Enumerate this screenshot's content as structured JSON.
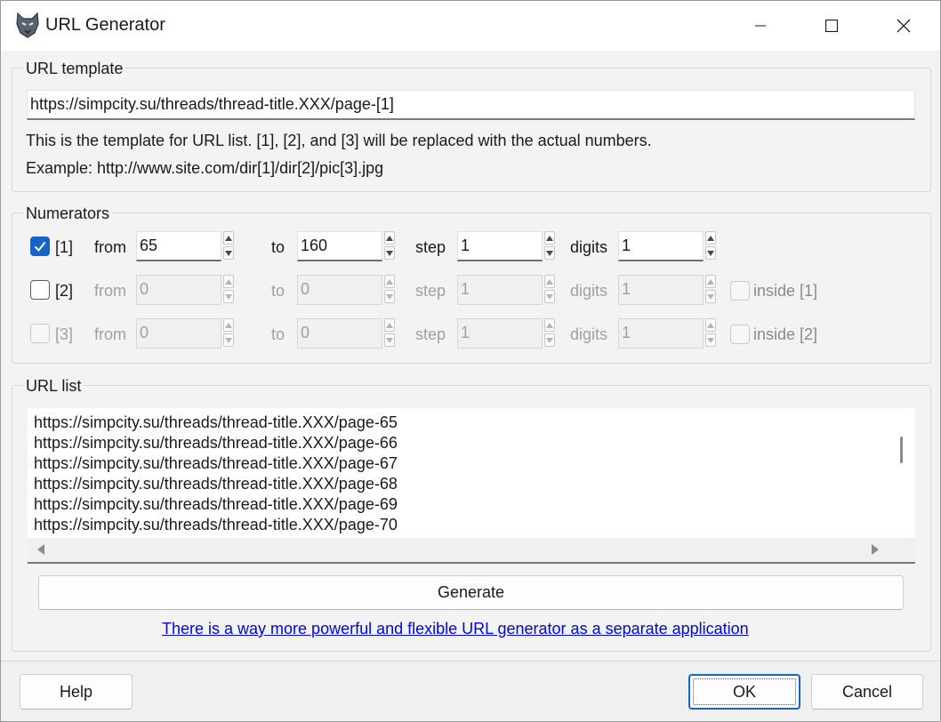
{
  "window": {
    "title": "URL Generator",
    "icon": "wolf-app-icon"
  },
  "template_group": {
    "label": "URL template",
    "value": "https://simpcity.su/threads/thread-title.XXX/page-[1]",
    "help_line1": "This is the template for URL list. [1], [2], and [3] will be replaced with the actual numbers.",
    "help_line2": "Example: http://www.site.com/dir[1]/dir[2]/pic[3].jpg"
  },
  "numerators": {
    "label": "Numerators",
    "from_label": "from",
    "to_label": "to",
    "step_label": "step",
    "digits_label": "digits",
    "rows": [
      {
        "tag": "[1]",
        "checked": true,
        "enabled": true,
        "from": "65",
        "to": "160",
        "step": "1",
        "digits": "1",
        "inside_label": ""
      },
      {
        "tag": "[2]",
        "checked": false,
        "enabled": true,
        "from": "0",
        "to": "0",
        "step": "1",
        "digits": "1",
        "inside_label": "inside [1]"
      },
      {
        "tag": "[3]",
        "checked": false,
        "enabled": false,
        "from": "0",
        "to": "0",
        "step": "1",
        "digits": "1",
        "inside_label": "inside [2]"
      }
    ]
  },
  "url_list": {
    "label": "URL list",
    "items": [
      "https://simpcity.su/threads/thread-title.XXX/page-65",
      "https://simpcity.su/threads/thread-title.XXX/page-66",
      "https://simpcity.su/threads/thread-title.XXX/page-67",
      "https://simpcity.su/threads/thread-title.XXX/page-68",
      "https://simpcity.su/threads/thread-title.XXX/page-69",
      "https://simpcity.su/threads/thread-title.XXX/page-70"
    ]
  },
  "generate_label": "Generate",
  "link_text": "There is a way more powerful and flexible URL generator as a separate application",
  "buttons": {
    "help": "Help",
    "ok": "OK",
    "cancel": "Cancel"
  },
  "colors": {
    "accent": "#1863c9",
    "link": "#0000ee"
  }
}
